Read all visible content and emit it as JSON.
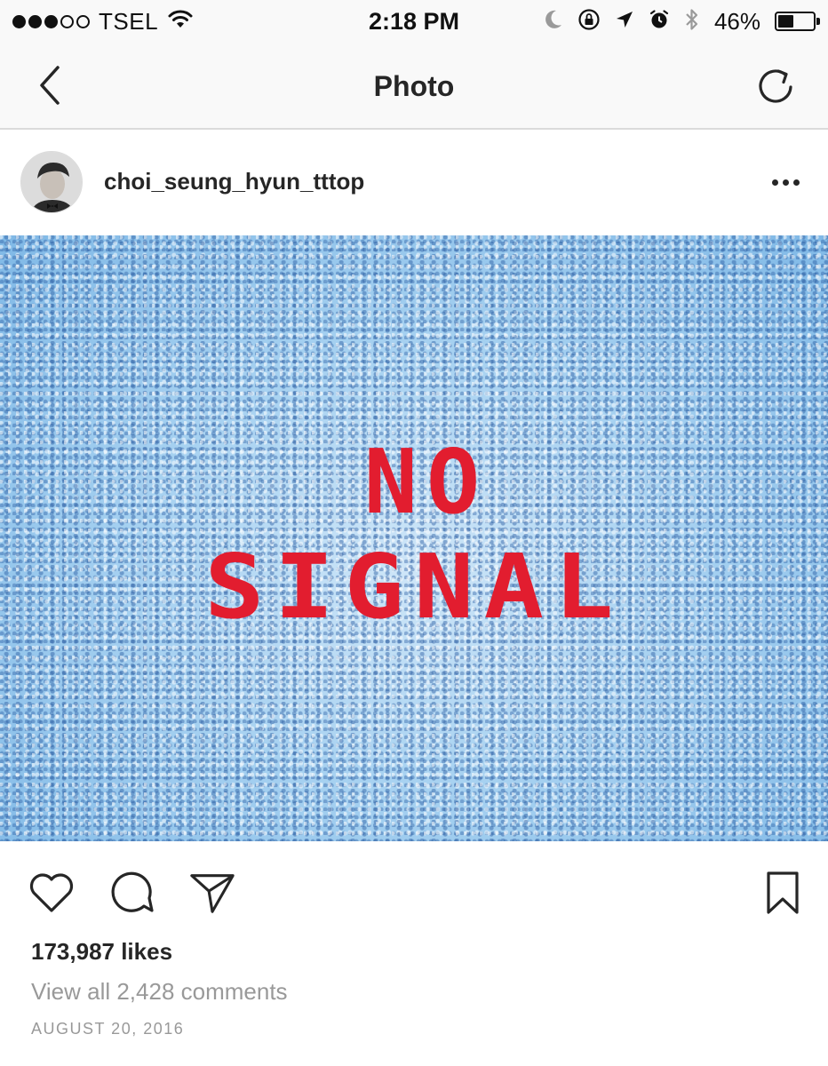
{
  "status_bar": {
    "carrier": "TSEL",
    "signal_bars_filled": 3,
    "signal_bars_total": 5,
    "time": "2:18 PM",
    "battery_percent": "46%",
    "battery_level": 0.46,
    "icons": [
      "wifi-icon",
      "moon-icon",
      "orientation-lock-icon",
      "location-arrow-icon",
      "alarm-icon",
      "bluetooth-icon",
      "battery-icon"
    ]
  },
  "nav": {
    "title": "Photo",
    "back_icon": "chevron-left-icon",
    "refresh_icon": "refresh-icon"
  },
  "post": {
    "username": "choi_seung_hyun_tttop",
    "more_icon": "more-dots-icon",
    "photo_text_line1": "NO",
    "photo_text_line2": "SIGNAL",
    "likes": "173,987 likes",
    "comments_link": "View all 2,428 comments",
    "date": "AUGUST 20, 2016"
  },
  "actions": {
    "icons": [
      "heart-icon",
      "comment-icon",
      "share-icon",
      "bookmark-icon"
    ]
  },
  "colors": {
    "photo_text": "#e21d2f",
    "photo_bg": "#8fc3ea",
    "secondary_text": "#999999",
    "primary_text": "#262626"
  }
}
